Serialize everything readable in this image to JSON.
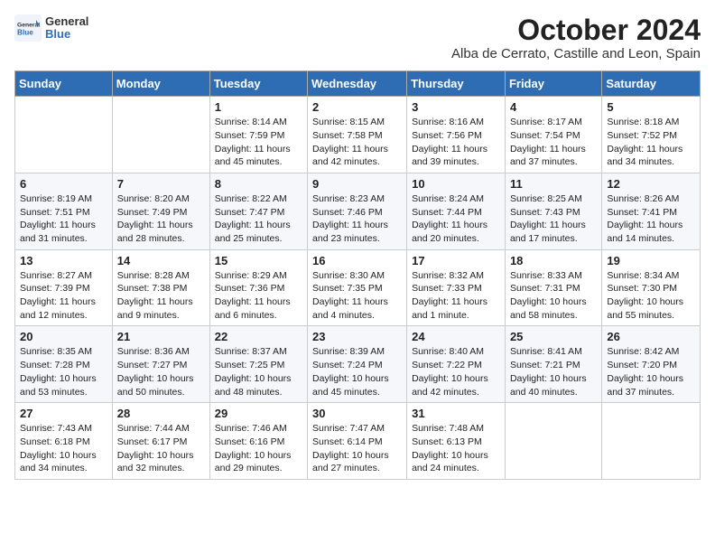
{
  "header": {
    "logo_general": "General",
    "logo_blue": "Blue",
    "month_title": "October 2024",
    "location": "Alba de Cerrato, Castille and Leon, Spain"
  },
  "days_of_week": [
    "Sunday",
    "Monday",
    "Tuesday",
    "Wednesday",
    "Thursday",
    "Friday",
    "Saturday"
  ],
  "weeks": [
    [
      {
        "day": "",
        "sunrise": "",
        "sunset": "",
        "daylight": ""
      },
      {
        "day": "",
        "sunrise": "",
        "sunset": "",
        "daylight": ""
      },
      {
        "day": "1",
        "sunrise": "Sunrise: 8:14 AM",
        "sunset": "Sunset: 7:59 PM",
        "daylight": "Daylight: 11 hours and 45 minutes."
      },
      {
        "day": "2",
        "sunrise": "Sunrise: 8:15 AM",
        "sunset": "Sunset: 7:58 PM",
        "daylight": "Daylight: 11 hours and 42 minutes."
      },
      {
        "day": "3",
        "sunrise": "Sunrise: 8:16 AM",
        "sunset": "Sunset: 7:56 PM",
        "daylight": "Daylight: 11 hours and 39 minutes."
      },
      {
        "day": "4",
        "sunrise": "Sunrise: 8:17 AM",
        "sunset": "Sunset: 7:54 PM",
        "daylight": "Daylight: 11 hours and 37 minutes."
      },
      {
        "day": "5",
        "sunrise": "Sunrise: 8:18 AM",
        "sunset": "Sunset: 7:52 PM",
        "daylight": "Daylight: 11 hours and 34 minutes."
      }
    ],
    [
      {
        "day": "6",
        "sunrise": "Sunrise: 8:19 AM",
        "sunset": "Sunset: 7:51 PM",
        "daylight": "Daylight: 11 hours and 31 minutes."
      },
      {
        "day": "7",
        "sunrise": "Sunrise: 8:20 AM",
        "sunset": "Sunset: 7:49 PM",
        "daylight": "Daylight: 11 hours and 28 minutes."
      },
      {
        "day": "8",
        "sunrise": "Sunrise: 8:22 AM",
        "sunset": "Sunset: 7:47 PM",
        "daylight": "Daylight: 11 hours and 25 minutes."
      },
      {
        "day": "9",
        "sunrise": "Sunrise: 8:23 AM",
        "sunset": "Sunset: 7:46 PM",
        "daylight": "Daylight: 11 hours and 23 minutes."
      },
      {
        "day": "10",
        "sunrise": "Sunrise: 8:24 AM",
        "sunset": "Sunset: 7:44 PM",
        "daylight": "Daylight: 11 hours and 20 minutes."
      },
      {
        "day": "11",
        "sunrise": "Sunrise: 8:25 AM",
        "sunset": "Sunset: 7:43 PM",
        "daylight": "Daylight: 11 hours and 17 minutes."
      },
      {
        "day": "12",
        "sunrise": "Sunrise: 8:26 AM",
        "sunset": "Sunset: 7:41 PM",
        "daylight": "Daylight: 11 hours and 14 minutes."
      }
    ],
    [
      {
        "day": "13",
        "sunrise": "Sunrise: 8:27 AM",
        "sunset": "Sunset: 7:39 PM",
        "daylight": "Daylight: 11 hours and 12 minutes."
      },
      {
        "day": "14",
        "sunrise": "Sunrise: 8:28 AM",
        "sunset": "Sunset: 7:38 PM",
        "daylight": "Daylight: 11 hours and 9 minutes."
      },
      {
        "day": "15",
        "sunrise": "Sunrise: 8:29 AM",
        "sunset": "Sunset: 7:36 PM",
        "daylight": "Daylight: 11 hours and 6 minutes."
      },
      {
        "day": "16",
        "sunrise": "Sunrise: 8:30 AM",
        "sunset": "Sunset: 7:35 PM",
        "daylight": "Daylight: 11 hours and 4 minutes."
      },
      {
        "day": "17",
        "sunrise": "Sunrise: 8:32 AM",
        "sunset": "Sunset: 7:33 PM",
        "daylight": "Daylight: 11 hours and 1 minute."
      },
      {
        "day": "18",
        "sunrise": "Sunrise: 8:33 AM",
        "sunset": "Sunset: 7:31 PM",
        "daylight": "Daylight: 10 hours and 58 minutes."
      },
      {
        "day": "19",
        "sunrise": "Sunrise: 8:34 AM",
        "sunset": "Sunset: 7:30 PM",
        "daylight": "Daylight: 10 hours and 55 minutes."
      }
    ],
    [
      {
        "day": "20",
        "sunrise": "Sunrise: 8:35 AM",
        "sunset": "Sunset: 7:28 PM",
        "daylight": "Daylight: 10 hours and 53 minutes."
      },
      {
        "day": "21",
        "sunrise": "Sunrise: 8:36 AM",
        "sunset": "Sunset: 7:27 PM",
        "daylight": "Daylight: 10 hours and 50 minutes."
      },
      {
        "day": "22",
        "sunrise": "Sunrise: 8:37 AM",
        "sunset": "Sunset: 7:25 PM",
        "daylight": "Daylight: 10 hours and 48 minutes."
      },
      {
        "day": "23",
        "sunrise": "Sunrise: 8:39 AM",
        "sunset": "Sunset: 7:24 PM",
        "daylight": "Daylight: 10 hours and 45 minutes."
      },
      {
        "day": "24",
        "sunrise": "Sunrise: 8:40 AM",
        "sunset": "Sunset: 7:22 PM",
        "daylight": "Daylight: 10 hours and 42 minutes."
      },
      {
        "day": "25",
        "sunrise": "Sunrise: 8:41 AM",
        "sunset": "Sunset: 7:21 PM",
        "daylight": "Daylight: 10 hours and 40 minutes."
      },
      {
        "day": "26",
        "sunrise": "Sunrise: 8:42 AM",
        "sunset": "Sunset: 7:20 PM",
        "daylight": "Daylight: 10 hours and 37 minutes."
      }
    ],
    [
      {
        "day": "27",
        "sunrise": "Sunrise: 7:43 AM",
        "sunset": "Sunset: 6:18 PM",
        "daylight": "Daylight: 10 hours and 34 minutes."
      },
      {
        "day": "28",
        "sunrise": "Sunrise: 7:44 AM",
        "sunset": "Sunset: 6:17 PM",
        "daylight": "Daylight: 10 hours and 32 minutes."
      },
      {
        "day": "29",
        "sunrise": "Sunrise: 7:46 AM",
        "sunset": "Sunset: 6:16 PM",
        "daylight": "Daylight: 10 hours and 29 minutes."
      },
      {
        "day": "30",
        "sunrise": "Sunrise: 7:47 AM",
        "sunset": "Sunset: 6:14 PM",
        "daylight": "Daylight: 10 hours and 27 minutes."
      },
      {
        "day": "31",
        "sunrise": "Sunrise: 7:48 AM",
        "sunset": "Sunset: 6:13 PM",
        "daylight": "Daylight: 10 hours and 24 minutes."
      },
      {
        "day": "",
        "sunrise": "",
        "sunset": "",
        "daylight": ""
      },
      {
        "day": "",
        "sunrise": "",
        "sunset": "",
        "daylight": ""
      }
    ]
  ]
}
